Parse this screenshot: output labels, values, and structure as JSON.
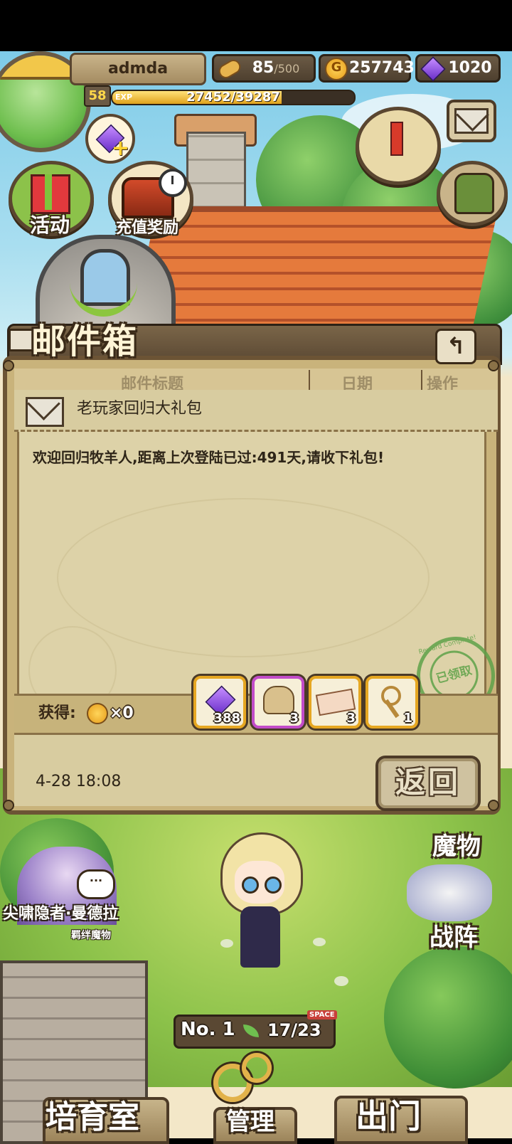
{
  "player": {
    "name": "admda",
    "level": "58",
    "exp_label": "EXP",
    "exp_text": "27452/39287",
    "exp_fraction": 0.699
  },
  "resources": {
    "stamina_value": "85",
    "stamina_max": "/500",
    "gold": "257743",
    "gems": "1020"
  },
  "quick_buttons": {
    "event_label": "活动",
    "recharge_label": "充值奖励"
  },
  "mailbox": {
    "title": "邮件箱",
    "columns": [
      "邮件标题",
      "日期",
      "操作"
    ],
    "subject": "老玩家回归大礼包",
    "body": "欢迎回归牧羊人,距离上次登陆已过:491天,请收下礼包!",
    "stamp_text": "已领取",
    "stamp_ring": "Reward Complete!",
    "obtain_label": "获得:",
    "obtain_gold": "×0",
    "rewards": [
      {
        "icon": "gem-icon",
        "count": "388"
      },
      {
        "icon": "food-bag-icon",
        "count": "3"
      },
      {
        "icon": "ticket-icon",
        "count": "3"
      },
      {
        "icon": "key-icon",
        "count": "1"
      }
    ],
    "date": "4-28 18:08",
    "return_label": "返回"
  },
  "scene": {
    "npc_name": "尖啸隐者·曼德拉",
    "npc_subtitle": "羁绊魔物",
    "chat_icon": "···",
    "monster_label": "魔物",
    "formation_label": "战阵",
    "rank": "No. 1",
    "space_tag": "SPACE",
    "space_count": "17/23"
  },
  "bottom_nav": {
    "nursery": "培育室",
    "manage": "管理",
    "depart": "出门"
  }
}
